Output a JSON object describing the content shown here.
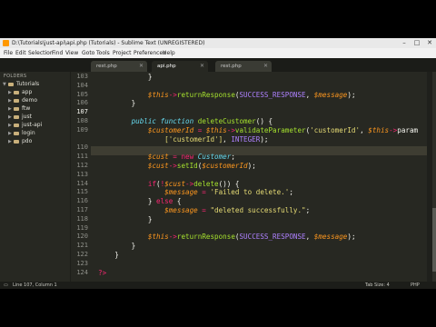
{
  "window": {
    "title": "D:\\Tutorials\\just-api\\api.php (Tutorials) - Sublime Text (UNREGISTERED)",
    "minimize": "–",
    "maximize": "□",
    "close": "✕"
  },
  "menu": [
    "File",
    "Edit",
    "Selection",
    "Find",
    "View",
    "Goto",
    "Tools",
    "Project",
    "Preferences",
    "Help"
  ],
  "tabs": [
    {
      "label": "rest.php",
      "active": false
    },
    {
      "label": "api.php",
      "active": true
    },
    {
      "label": "rest.php",
      "active": false
    }
  ],
  "sidebar": {
    "header": "FOLDERS",
    "root": "Tutorials",
    "folders": [
      "app",
      "demo",
      "ftw",
      "just",
      "just-api",
      "login",
      "pdo"
    ]
  },
  "editor": {
    "lines": [
      {
        "n": "103",
        "tokens": [
          [
            "            ",
            "pl"
          ],
          [
            "}",
            "pl"
          ]
        ]
      },
      {
        "n": "104",
        "tokens": []
      },
      {
        "n": "105",
        "tokens": [
          [
            "            ",
            "pl"
          ],
          [
            "$this",
            "this"
          ],
          [
            "->",
            "op"
          ],
          [
            "returnResponse",
            "fn"
          ],
          [
            "(",
            "pl"
          ],
          [
            "SUCCESS_RESPONSE",
            "const"
          ],
          [
            ", ",
            "pl"
          ],
          [
            "$message",
            "var"
          ],
          [
            ");",
            "pl"
          ]
        ]
      },
      {
        "n": "106",
        "tokens": [
          [
            "        ",
            "pl"
          ],
          [
            "}",
            "pl"
          ]
        ]
      },
      {
        "n": "107",
        "tokens": []
      },
      {
        "n": "108",
        "tokens": [
          [
            "        ",
            "pl"
          ],
          [
            "public ",
            "kw"
          ],
          [
            "function ",
            "kw"
          ],
          [
            "deleteCustomer",
            "fn"
          ],
          [
            "() {",
            "pl"
          ]
        ]
      },
      {
        "n": "109",
        "tokens": [
          [
            "            ",
            "pl"
          ],
          [
            "$customerId",
            "var"
          ],
          [
            " = ",
            "op"
          ],
          [
            "$this",
            "this"
          ],
          [
            "->",
            "op"
          ],
          [
            "validateParameter",
            "fn"
          ],
          [
            "(",
            "pl"
          ],
          [
            "'customerId'",
            "str"
          ],
          [
            ", ",
            "pl"
          ],
          [
            "$this",
            "this"
          ],
          [
            "->",
            "op"
          ],
          [
            "param",
            "pl"
          ]
        ]
      },
      {
        "n": "",
        "tokens": [
          [
            "                ",
            "pl"
          ],
          [
            "['customerId']",
            "str"
          ],
          [
            ", ",
            "pl"
          ],
          [
            "INTEGER",
            "const"
          ],
          [
            ");",
            "pl"
          ]
        ]
      },
      {
        "n": "110",
        "tokens": []
      },
      {
        "n": "111",
        "tokens": [
          [
            "            ",
            "pl"
          ],
          [
            "$cust",
            "var"
          ],
          [
            " = ",
            "op"
          ],
          [
            "new ",
            "op"
          ],
          [
            "Customer",
            "cls"
          ],
          [
            ";",
            "pl"
          ]
        ]
      },
      {
        "n": "112",
        "tokens": [
          [
            "            ",
            "pl"
          ],
          [
            "$cust",
            "var"
          ],
          [
            "->",
            "op"
          ],
          [
            "setId",
            "fn"
          ],
          [
            "(",
            "pl"
          ],
          [
            "$customerId",
            "var"
          ],
          [
            ");",
            "pl"
          ]
        ]
      },
      {
        "n": "113",
        "tokens": []
      },
      {
        "n": "114",
        "tokens": [
          [
            "            ",
            "pl"
          ],
          [
            "if",
            "op"
          ],
          [
            "(",
            "pl"
          ],
          [
            "!",
            "op"
          ],
          [
            "$cust",
            "var"
          ],
          [
            "->",
            "op"
          ],
          [
            "delete",
            "fn"
          ],
          [
            "()) {",
            "pl"
          ]
        ]
      },
      {
        "n": "115",
        "tokens": [
          [
            "                ",
            "pl"
          ],
          [
            "$message",
            "var"
          ],
          [
            " = ",
            "op"
          ],
          [
            "'Failed to delete.'",
            "str"
          ],
          [
            ";",
            "pl"
          ]
        ]
      },
      {
        "n": "116",
        "tokens": [
          [
            "            ",
            "pl"
          ],
          [
            "} ",
            "pl"
          ],
          [
            "else ",
            "op"
          ],
          [
            "{",
            "pl"
          ]
        ]
      },
      {
        "n": "117",
        "tokens": [
          [
            "                ",
            "pl"
          ],
          [
            "$message",
            "var"
          ],
          [
            " = ",
            "op"
          ],
          [
            "\"deleted successfully.\"",
            "str"
          ],
          [
            ";",
            "pl"
          ]
        ]
      },
      {
        "n": "118",
        "tokens": [
          [
            "            ",
            "pl"
          ],
          [
            "}",
            "pl"
          ]
        ]
      },
      {
        "n": "119",
        "tokens": []
      },
      {
        "n": "120",
        "tokens": [
          [
            "            ",
            "pl"
          ],
          [
            "$this",
            "this"
          ],
          [
            "->",
            "op"
          ],
          [
            "returnResponse",
            "fn"
          ],
          [
            "(",
            "pl"
          ],
          [
            "SUCCESS_RESPONSE",
            "const"
          ],
          [
            ", ",
            "pl"
          ],
          [
            "$message",
            "var"
          ],
          [
            ");",
            "pl"
          ]
        ]
      },
      {
        "n": "121",
        "tokens": [
          [
            "        ",
            "pl"
          ],
          [
            "}",
            "pl"
          ]
        ]
      },
      {
        "n": "122",
        "tokens": [
          [
            "    ",
            "pl"
          ],
          [
            "}",
            "pl"
          ]
        ]
      },
      {
        "n": "123",
        "tokens": []
      },
      {
        "n": "124",
        "tokens": [
          [
            "?>",
            "op"
          ]
        ]
      }
    ],
    "current_line_number": "107"
  },
  "status": {
    "position": "Line 107, Column 1",
    "tab_size": "Tab Size: 4",
    "syntax": "PHP"
  },
  "colors": {
    "background": "#272822",
    "keyword": "#66d9ef",
    "operator": "#f92672",
    "function": "#a6e22e",
    "string": "#e6db74",
    "constant": "#ae81ff",
    "variable": "#fd971f"
  }
}
